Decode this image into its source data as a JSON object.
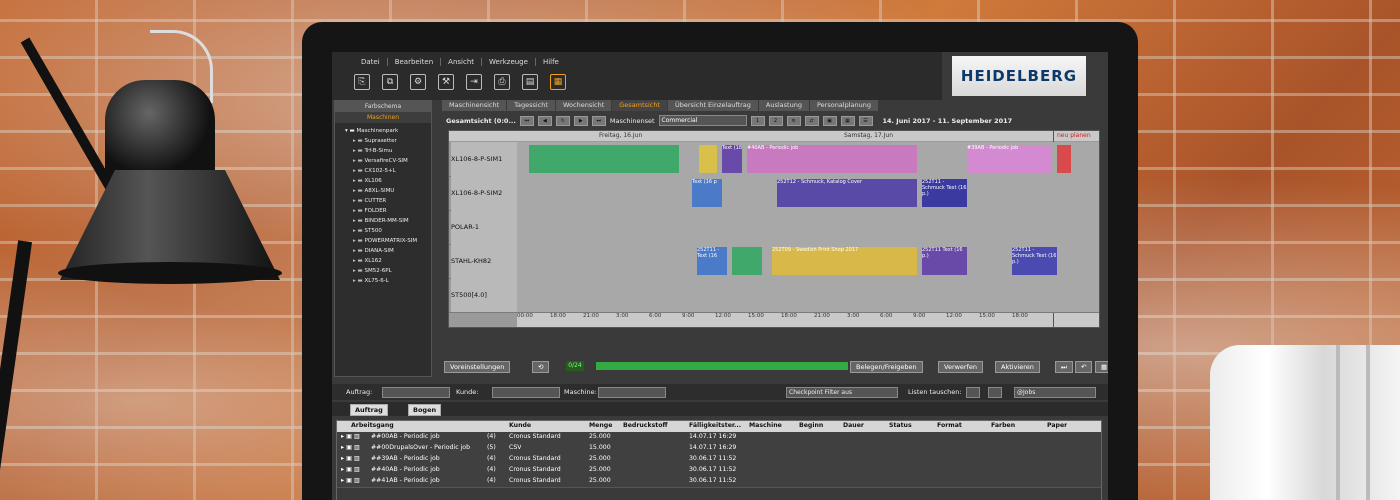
{
  "menus": [
    "Datei",
    "Bearbeiten",
    "Ansicht",
    "Werkzeuge",
    "Hilfe"
  ],
  "toolbar_icons": [
    "new-icon",
    "copy-icon",
    "properties-icon",
    "settings-icon",
    "export-icon",
    "print-icon",
    "document-icon",
    "calculator-icon"
  ],
  "logo_text": "HEIDELBERG",
  "left_panel": {
    "title": "Farbschema",
    "tab_selected": "Maschinen",
    "root": "Maschinenpark",
    "items": [
      "Suprasetter",
      "Trf-B-Simu",
      "VersafireCV-SIM",
      "CX102-5+L",
      "XL106",
      "A8XL-SIMU",
      "CUTTER",
      "FOLDER",
      "BINDER-MM-SIM",
      "ST500",
      "POWERMATRIX-SIM",
      "DIANA-SIM",
      "XL162",
      "SM52-6PL",
      "XL75-6-L"
    ]
  },
  "tabs": [
    "Maschinensicht",
    "Tagessicht",
    "Wochensicht",
    "Gesamtsicht",
    "Übersicht Einzelauftrag",
    "Auslastung",
    "Personalplanung"
  ],
  "tab_selected": "Gesamtsicht",
  "ctrl": {
    "view_label": "Gesamtsicht  (0:0...",
    "machineset_label": "Maschinenset",
    "machineset_value": "Commercial",
    "date_range": "14. Juni 2017  -  11. September 2017"
  },
  "gantt": {
    "day_labels": [
      "Freitag, 16.Jun",
      "Samstag, 17.Jun"
    ],
    "neu_planen": "neu planen",
    "rows": [
      {
        "label": "XL106-8-P-SIM1",
        "bars": [
          {
            "text": "",
            "color": "#3fa86a"
          },
          {
            "text": "",
            "color": "#d9c04a"
          },
          {
            "text": "Text (18",
            "color": "#6a4aa8"
          },
          {
            "text": "#40AB - Periodic job",
            "color": "#c77ac0"
          },
          {
            "text": "#39AB - Periodic job",
            "color": "#d38ad0"
          },
          {
            "text": "",
            "color": "#d94a4a"
          }
        ]
      },
      {
        "label": "XL106-8-P-SIM2",
        "bars": [
          {
            "text": "Text (16 p",
            "color": "#4a7ac8"
          },
          {
            "text": "252T12 - Schmuck, Katalog Cover",
            "color": "#5a4aa8"
          },
          {
            "text": "252T11 - Schmuck Text (16 p.)",
            "color": "#3a3aa0"
          }
        ]
      },
      {
        "label": "POLAR-1",
        "bars": []
      },
      {
        "label": "STAHL-KH82",
        "bars": [
          {
            "text": "252T11 - Text (16",
            "color": "#4a7ac8"
          },
          {
            "text": "",
            "color": "#3fa86a"
          },
          {
            "text": "252T09 - Swedish Print Shop 2017",
            "color": "#d9b84a"
          },
          {
            "text": "252T11 Text (16 p.)",
            "color": "#6a4aa8"
          },
          {
            "text": "252T11 - Schmuck Text (16 p.)",
            "color": "#4a4ab0"
          }
        ]
      },
      {
        "label": "ST500[4.0]",
        "bars": []
      }
    ],
    "axis_ticks": [
      "00:00",
      "18:00",
      "21:00",
      "3:00",
      "6:00",
      "9:00",
      "12:00",
      "15:00",
      "18:00",
      "21:00",
      "3:00",
      "6:00",
      "9:00",
      "12:00",
      "15:00",
      "18:00"
    ]
  },
  "controls": {
    "voreinstellungen": "Voreinstellungen",
    "counter": "0/24",
    "belegen": "Belegen/Freigeben",
    "verwerfen": "Verwerfen",
    "aktivieren": "Aktivieren"
  },
  "filter": {
    "auftrag_label": "Auftrag:",
    "kunde_label": "Kunde:",
    "maschine_label": "Maschine:",
    "checkpoint": "Checkpoint Filter aus",
    "listen_label": "Listen tauschen:",
    "jobs_value": "@Jobs"
  },
  "group": {
    "chip1": "Auftrag",
    "chip2": "Bogen"
  },
  "table": {
    "columns": [
      "Arbeitsgang",
      "Kunde",
      "Menge",
      "Bedruckstoff",
      "Fälligkeitster...",
      "Maschine",
      "Beginn",
      "Dauer",
      "Status",
      "Format",
      "Farben",
      "Paper"
    ],
    "rows": [
      {
        "arbeitsgang": "##00AB - Periodic job",
        "n": "(4)",
        "kunde": "Cronus Standard",
        "menge": "25.000",
        "faellig": "14.07.17 16:29"
      },
      {
        "arbeitsgang": "##00DrupalsOver - Periodic job",
        "n": "(5)",
        "kunde": "CSV",
        "menge": "15.000",
        "faellig": "14.07.17 16:29"
      },
      {
        "arbeitsgang": "##39AB - Periodic job",
        "n": "(4)",
        "kunde": "Cronus Standard",
        "menge": "25.000",
        "faellig": "30.06.17 11:52"
      },
      {
        "arbeitsgang": "##40AB - Periodic job",
        "n": "(4)",
        "kunde": "Cronus Standard",
        "menge": "25.000",
        "faellig": "30.06.17 11:52"
      },
      {
        "arbeitsgang": "##41AB - Periodic job",
        "n": "(4)",
        "kunde": "Cronus Standard",
        "menge": "25.000",
        "faellig": "30.06.17 11:52"
      }
    ]
  }
}
